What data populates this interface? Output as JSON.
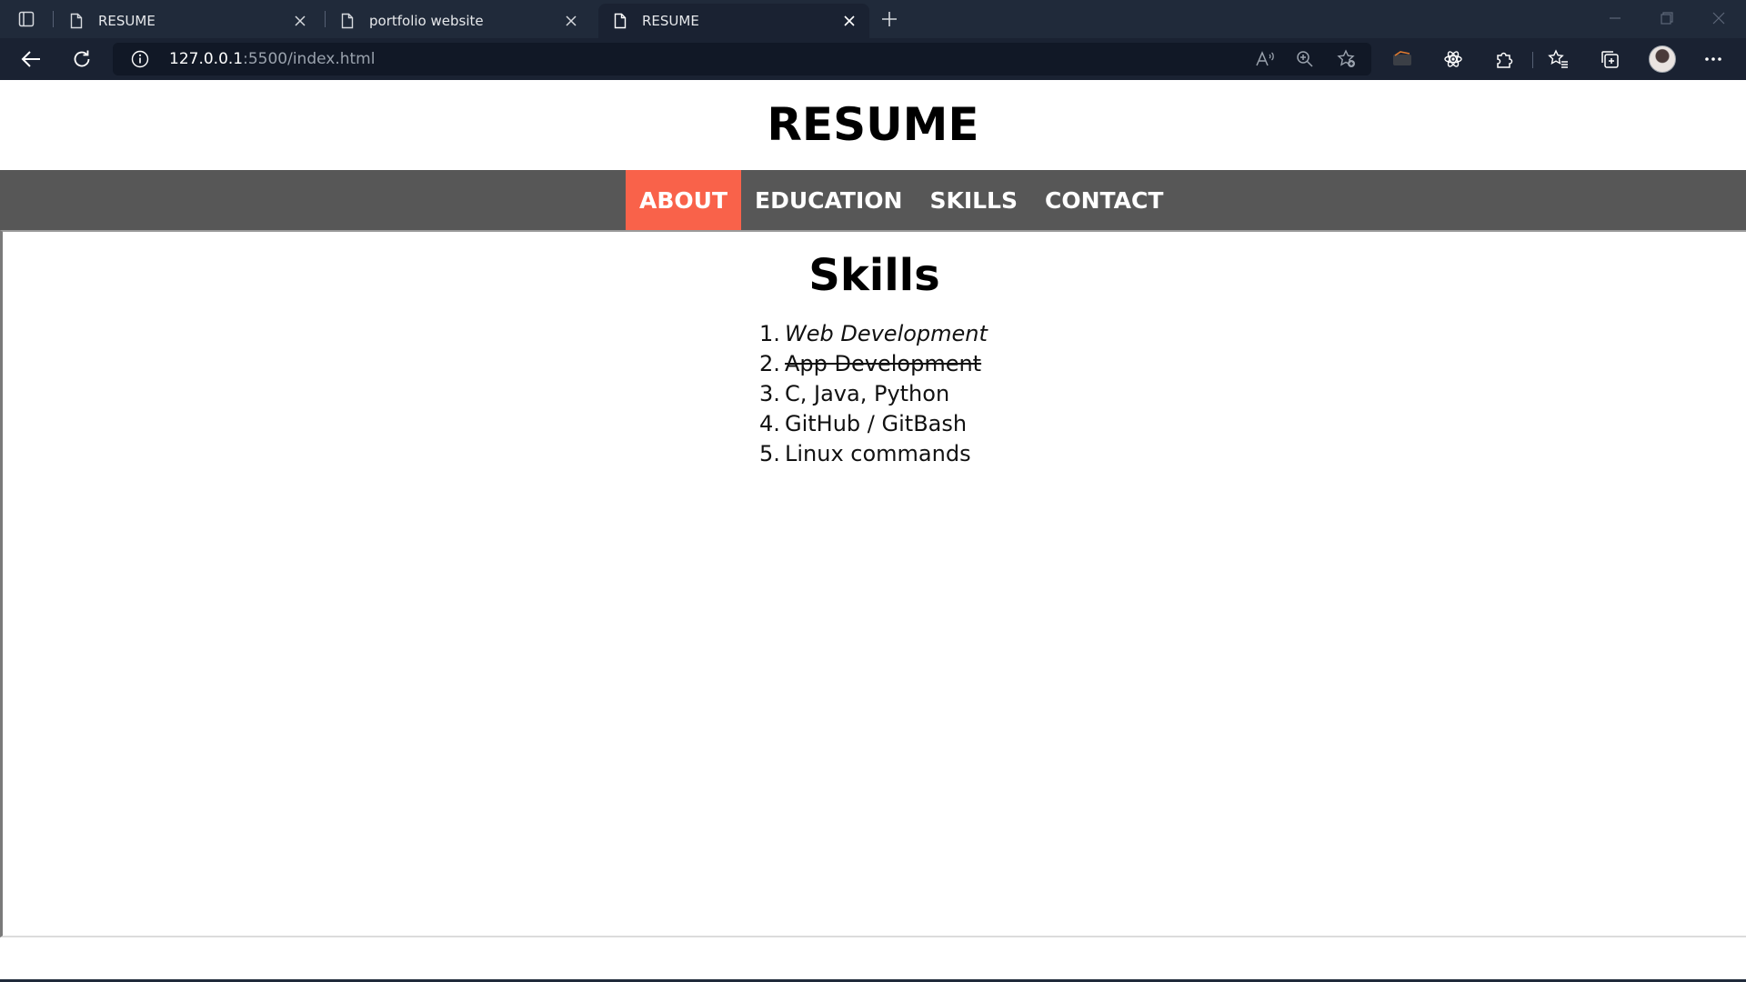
{
  "browser": {
    "tabs": [
      {
        "title": "RESUME",
        "active": false
      },
      {
        "title": "portfolio website",
        "active": false
      },
      {
        "title": "RESUME",
        "active": true
      }
    ],
    "url_host": "127.0.0.1",
    "url_path": ":5500/index.html",
    "icons": {
      "tab_actions": "tab-actions-icon",
      "page": "page-icon",
      "close": "close-icon",
      "new_tab": "plus-icon",
      "back": "back-arrow-icon",
      "refresh": "refresh-icon",
      "info": "info-icon",
      "read_aloud": "read-aloud-icon",
      "zoom": "zoom-icon",
      "favorite_add": "add-favorite-icon",
      "extensions": "puzzle-icon",
      "favorites": "favorites-icon",
      "collections": "collections-icon",
      "more": "more-icon"
    },
    "colors": {
      "tabbar": "#202a3a",
      "toolbar": "#1a2232"
    }
  },
  "site": {
    "title": "RESUME",
    "nav": [
      {
        "label": "ABOUT",
        "active": true
      },
      {
        "label": "EDUCATION",
        "active": false
      },
      {
        "label": "SKILLS",
        "active": false
      },
      {
        "label": "CONTACT",
        "active": false
      }
    ],
    "colors": {
      "nav_bg": "#575757",
      "active": "#f9624a"
    }
  },
  "skills": {
    "heading": "Skills",
    "items": [
      {
        "num": "1.",
        "text": "Web Development",
        "style": "italic"
      },
      {
        "num": "2.",
        "text": "App Development",
        "style": "strikethrough"
      },
      {
        "num": "3.",
        "text": "C, Java, Python",
        "style": "normal"
      },
      {
        "num": "4.",
        "text": "GitHub / GitBash",
        "style": "normal"
      },
      {
        "num": "5.",
        "text": "Linux commands",
        "style": "normal"
      }
    ]
  }
}
